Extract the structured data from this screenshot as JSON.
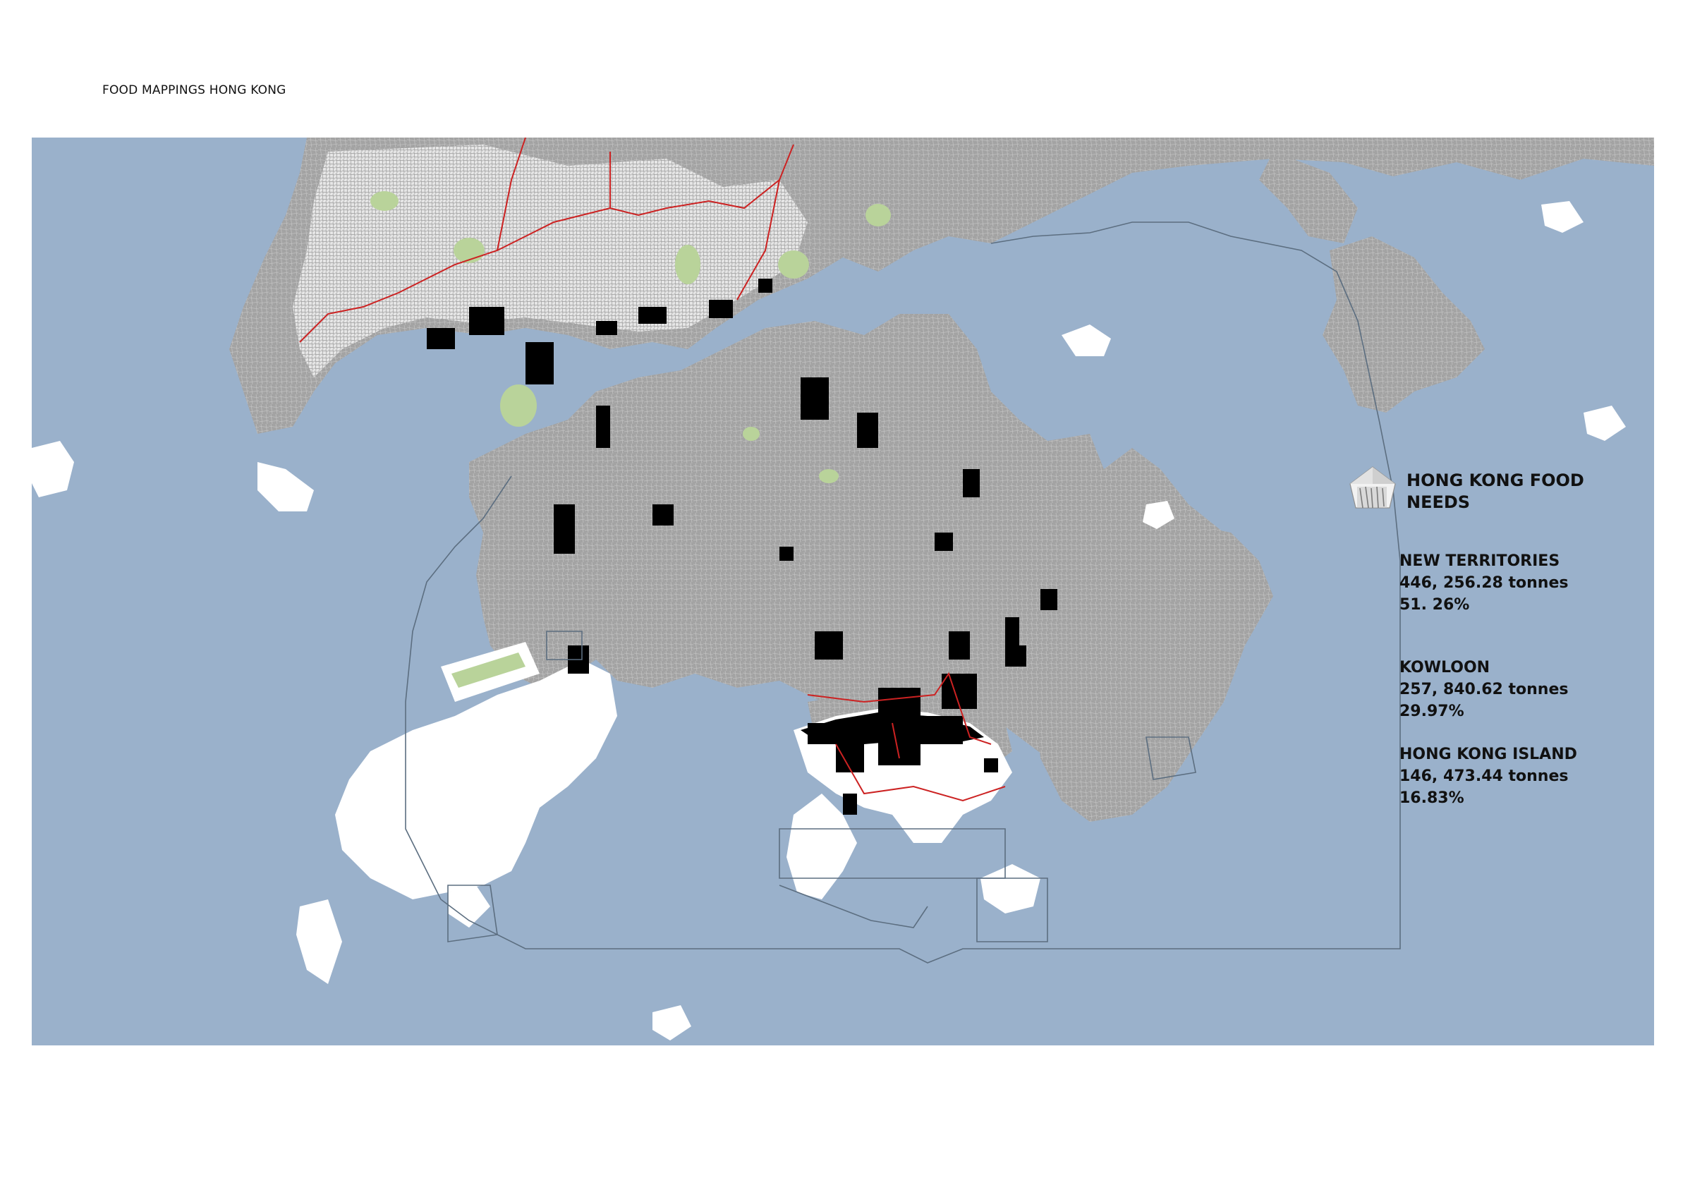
{
  "page": {
    "title": "FOOD MAPPINGS HONG KONG"
  },
  "colors": {
    "sea": "#9ab1cb",
    "urban_land": "#a3a3a3",
    "outlying_land": "#ffffff",
    "food_points": "#000000",
    "green_space": "#b9d39a",
    "district_boundary": "#cc2222",
    "territory_boundary": "#5c6e80"
  },
  "legend": {
    "logo_icon": "crystal-gem-icon",
    "title": "HONG KONG FOOD NEEDS",
    "regions": [
      {
        "name": "NEW TERRITORIES",
        "tonnes": "446, 256.28 tonnes",
        "percent": "51. 26%"
      },
      {
        "name": "KOWLOON",
        "tonnes": "257, 840.62 tonnes",
        "percent": "29.97%"
      },
      {
        "name": "HONG KONG ISLAND",
        "tonnes": "146, 473.44 tonnes",
        "percent": "16.83%"
      }
    ]
  }
}
